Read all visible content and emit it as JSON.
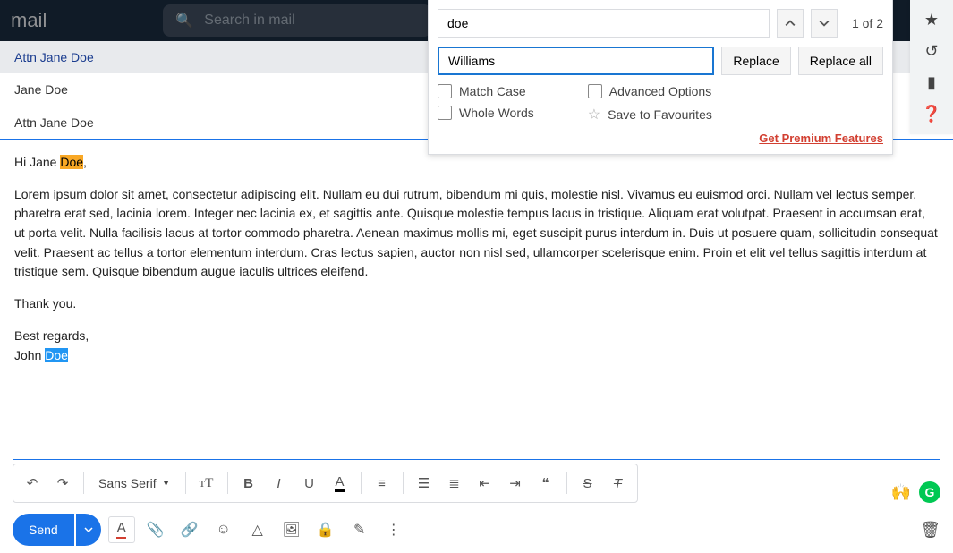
{
  "topbar": {
    "logo": "mail",
    "search_placeholder": "Search in mail"
  },
  "compose": {
    "window_title": "Attn Jane Doe",
    "recipient": "Jane Doe",
    "subject": "Attn Jane Doe"
  },
  "body": {
    "greeting_pre": "Hi Jane ",
    "greeting_hl": "Doe",
    "greeting_post": ",",
    "para": "Lorem ipsum dolor sit amet, consectetur adipiscing elit. Nullam eu dui rutrum, bibendum mi quis, molestie nisl. Vivamus eu euismod orci. Nullam vel lectus semper, pharetra erat sed, lacinia lorem. Integer nec lacinia ex, et sagittis ante. Quisque molestie tempus lacus in tristique. Aliquam erat volutpat. Praesent in accumsan erat, ut porta velit. Nulla facilisis lacus at tortor commodo pharetra. Aenean maximus mollis mi, eget suscipit purus interdum in. Duis ut posuere quam, sollicitudin consequat velit. Praesent ac tellus a tortor elementum interdum. Cras lectus sapien, auctor non nisl sed, ullamcorper scelerisque enim. Proin et elit vel tellus sagittis interdum at tristique sem. Quisque bibendum augue iaculis ultrices eleifend.",
    "thanks": "Thank you.",
    "regards": "Best regards,",
    "sign_pre": "John ",
    "sign_hl": "Doe"
  },
  "find": {
    "search_value": "doe",
    "replace_value": "Williams",
    "count": "1 of 2",
    "replace_label": "Replace",
    "replace_all_label": "Replace all",
    "match_case": "Match Case",
    "whole_words": "Whole Words",
    "advanced": "Advanced Options",
    "save_fav": "Save to Favourites",
    "premium": "Get Premium Features"
  },
  "format": {
    "font": "Sans Serif"
  },
  "actions": {
    "send": "Send"
  }
}
